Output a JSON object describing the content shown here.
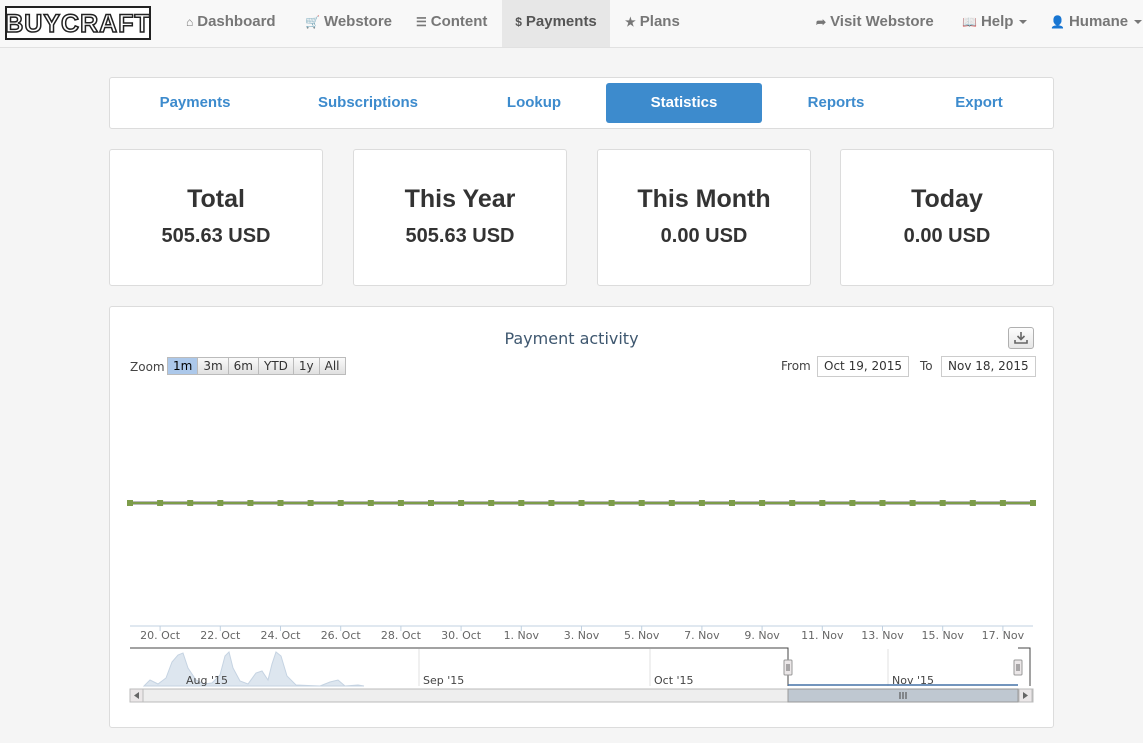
{
  "navbar": {
    "logo_text": "BUYCRAFT",
    "items": [
      {
        "label": "Dashboard",
        "icon": "home-icon"
      },
      {
        "label": "Webstore",
        "icon": "cart-icon"
      },
      {
        "label": "Content",
        "icon": "list-icon"
      },
      {
        "label": "Payments",
        "icon": "dollar-icon"
      },
      {
        "label": "Plans",
        "icon": "star-icon"
      }
    ],
    "right": [
      {
        "label": "Visit Webstore",
        "icon": "share-icon"
      },
      {
        "label": "Help",
        "icon": "book-icon"
      },
      {
        "label": "Humane",
        "icon": "user-icon"
      }
    ]
  },
  "subnav": {
    "tabs": [
      "Payments",
      "Subscriptions",
      "Lookup",
      "Statistics",
      "Reports",
      "Export"
    ],
    "active": "Statistics"
  },
  "stats": [
    {
      "title": "Total",
      "value": "505.63 USD"
    },
    {
      "title": "This Year",
      "value": "505.63 USD"
    },
    {
      "title": "This Month",
      "value": "0.00 USD"
    },
    {
      "title": "Today",
      "value": "0.00 USD"
    }
  ],
  "chart": {
    "title": "Payment activity",
    "zoom_label": "Zoom",
    "zoom_buttons": [
      "1m",
      "3m",
      "6m",
      "YTD",
      "1y",
      "All"
    ],
    "zoom_selected": "1m",
    "from_label": "From",
    "from_value": "Oct 19, 2015",
    "to_label": "To",
    "to_value": "Nov 18, 2015",
    "navigator_labels": [
      "Aug '15",
      "Sep '15",
      "Oct '15",
      "Nov '15"
    ]
  },
  "chart_data": {
    "type": "line",
    "title": "Payment activity",
    "x": [
      "Oct 19",
      "Oct 20",
      "Oct 21",
      "Oct 22",
      "Oct 23",
      "Oct 24",
      "Oct 25",
      "Oct 26",
      "Oct 27",
      "Oct 28",
      "Oct 29",
      "Oct 30",
      "Oct 31",
      "Nov 1",
      "Nov 2",
      "Nov 3",
      "Nov 4",
      "Nov 5",
      "Nov 6",
      "Nov 7",
      "Nov 8",
      "Nov 9",
      "Nov 10",
      "Nov 11",
      "Nov 12",
      "Nov 13",
      "Nov 14",
      "Nov 15",
      "Nov 16",
      "Nov 17",
      "Nov 18"
    ],
    "series": [
      {
        "values": [
          0,
          0,
          0,
          0,
          0,
          0,
          0,
          0,
          0,
          0,
          0,
          0,
          0,
          0,
          0,
          0,
          0,
          0,
          0,
          0,
          0,
          0,
          0,
          0,
          0,
          0,
          0,
          0,
          0,
          0,
          0
        ],
        "color": "#7d9c4a"
      }
    ],
    "xtick_labels": [
      "20. Oct",
      "22. Oct",
      "24. Oct",
      "26. Oct",
      "28. Oct",
      "30. Oct",
      "1. Nov",
      "3. Nov",
      "5. Nov",
      "7. Nov",
      "9. Nov",
      "11. Nov",
      "13. Nov",
      "15. Nov",
      "17. Nov"
    ],
    "grid": false
  }
}
